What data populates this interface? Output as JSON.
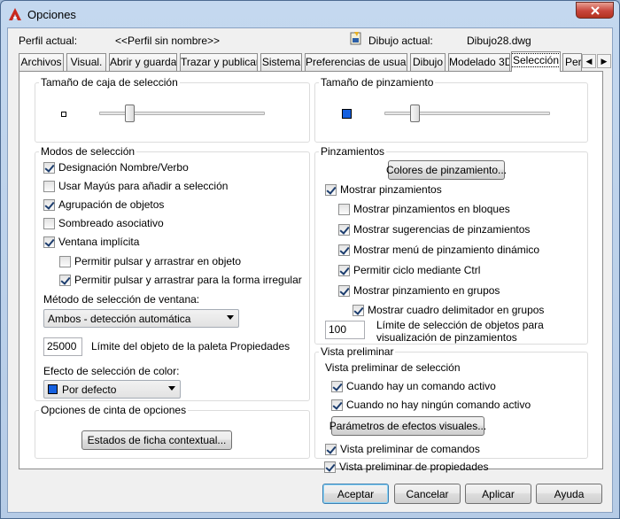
{
  "window": {
    "title": "Opciones"
  },
  "header": {
    "profile_label": "Perfil actual:",
    "profile_value": "<<Perfil sin nombre>>",
    "drawing_label": "Dibujo actual:",
    "drawing_value": "Dibujo28.dwg"
  },
  "tabs": [
    "Archivos",
    "Visual.",
    "Abrir y guardar",
    "Trazar y publicar",
    "Sistema",
    "Preferencias de usuario",
    "Dibujo",
    "Modelado 3D",
    "Selección",
    "Per"
  ],
  "active_tab": "Selección",
  "left": {
    "pickbox": {
      "title": "Tamaño de caja de selección",
      "level": 0.3
    },
    "modes": {
      "title": "Modos de selección",
      "items": [
        {
          "label": "Designación Nombre/Verbo",
          "checked": true
        },
        {
          "label": "Usar Mayús para añadir a selección",
          "checked": false
        },
        {
          "label": "Agrupación de objetos",
          "checked": true
        },
        {
          "label": "Sombreado asociativo",
          "checked": false
        },
        {
          "label": "Ventana implícita",
          "checked": true
        },
        {
          "label": "Permitir pulsar y arrastrar en objeto",
          "checked": false
        },
        {
          "label": "Permitir pulsar y arrastrar para la forma irregular",
          "checked": true
        }
      ],
      "window_method_label": "Método de selección de ventana:",
      "window_method_value": "Ambos - detección automática",
      "limit_value": "25000",
      "limit_label": "Límite del objeto de la paleta Propiedades",
      "color_effect_label": "Efecto de selección de color:",
      "color_effect_value": "Por defecto",
      "color_effect_swatch": "#1560e0"
    },
    "ribbon": {
      "title": "Opciones de cinta de opciones",
      "button": "Estados de ficha contextual..."
    }
  },
  "right": {
    "gripsize": {
      "title": "Tamaño de pinzamiento",
      "level": 0.3,
      "swatch": "#1560e0"
    },
    "grips": {
      "title": "Pinzamientos",
      "colors_button": "Colores de pinzamiento...",
      "items": [
        {
          "label": "Mostrar pinzamientos",
          "checked": true
        },
        {
          "label": "Mostrar pinzamientos en bloques",
          "checked": false
        },
        {
          "label": "Mostrar sugerencias de pinzamientos",
          "checked": true
        },
        {
          "label": "Mostrar menú de pinzamiento dinámico",
          "checked": true
        },
        {
          "label": "Permitir ciclo mediante Ctrl",
          "checked": true
        },
        {
          "label": "Mostrar pinzamiento en grupos",
          "checked": true
        },
        {
          "label": "Mostrar cuadro delimitador en grupos",
          "checked": true
        }
      ],
      "limit_value": "100",
      "limit_label_1": "Límite de selección de objetos para",
      "limit_label_2": "visualización de pinzamientos"
    },
    "preview": {
      "title": "Vista preliminar",
      "subtitle": "Vista preliminar de selección",
      "items": [
        {
          "label": "Cuando hay un comando activo",
          "checked": true
        },
        {
          "label": "Cuando no hay ningún comando activo",
          "checked": true
        },
        {
          "label": "Vista preliminar de comandos",
          "checked": true
        },
        {
          "label": "Vista preliminar de propiedades",
          "checked": true
        }
      ],
      "effects_button": "Parámetros de efectos visuales..."
    }
  },
  "footer": {
    "accept": "Aceptar",
    "cancel": "Cancelar",
    "apply": "Aplicar",
    "help": "Ayuda"
  }
}
